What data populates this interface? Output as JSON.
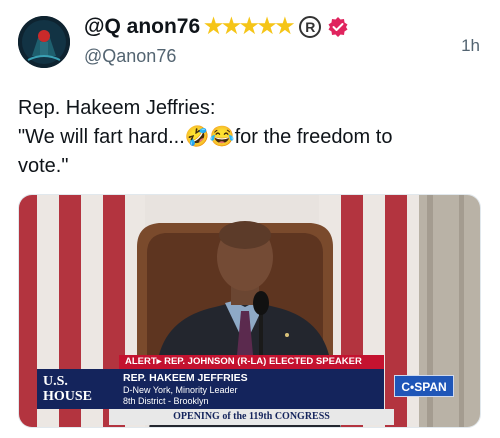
{
  "header": {
    "display_name": "@Q anon76",
    "stars": "★★★★★",
    "reg_mark": "R",
    "handle": "@Qanon76",
    "timestamp": "1h"
  },
  "tweet": {
    "line1": "Rep. Hakeem Jeffries:",
    "line2_start": "\"We will fart hard...",
    "emojis": "🤣😂",
    "line2_end": "for the freedom to",
    "line3": "vote.\""
  },
  "video": {
    "alert_label": "ALERT▸",
    "alert_text": "REP. JOHNSON (R-LA) ELECTED SPEAKER",
    "lower_third_name": "REP. HAKEEM JEFFRIES",
    "lower_third_title": "D-New York, Minority Leader",
    "lower_third_district": "8th District - Brooklyn",
    "house_line1": "U.S.",
    "house_line2": "HOUSE",
    "network": "C•SPAN",
    "opening_text": "OPENING of the 119th CONGRESS"
  },
  "colors": {
    "star": "#f5c518",
    "verified": "#e0245e",
    "cspan_red": "#c4122f",
    "cspan_blue": "#14245c"
  }
}
